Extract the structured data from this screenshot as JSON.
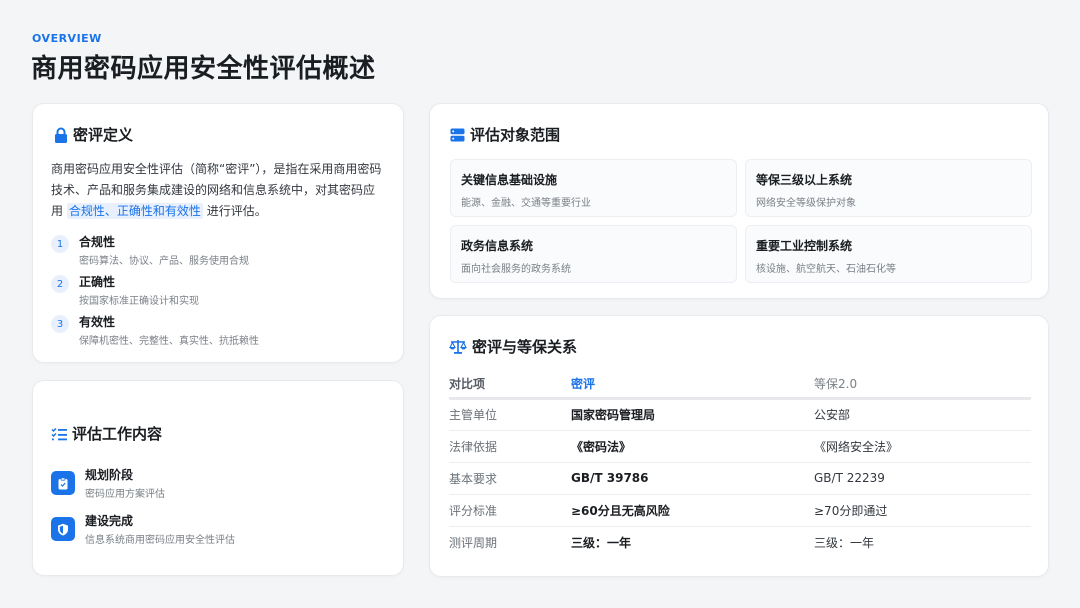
{
  "header": {
    "kicker": "OVERVIEW",
    "title": "商用密码应用安全性评估概述"
  },
  "colors": {
    "accent": "#1a73e8",
    "background": "#f4f5f7"
  },
  "definition": {
    "icon": "lock-icon",
    "title": "密评定义",
    "text_before": "商用密码应用安全性评估（简称“密评”），是指在采用商用密码技术、产品和服务集成建设的网络和信息系统中，对其密码应用",
    "highlight": "合规性、正确性和有效性",
    "text_after": "进行评估。",
    "criteria": [
      {
        "num": "1",
        "name": "合规性",
        "desc": "密码算法、协议、产品、服务使用合规"
      },
      {
        "num": "2",
        "name": "正确性",
        "desc": "按国家标准正确设计和实现"
      },
      {
        "num": "3",
        "name": "有效性",
        "desc": "保障机密性、完整性、真实性、抗抵赖性"
      }
    ]
  },
  "work": {
    "icon": "checklist-icon",
    "title": "评估工作内容",
    "items": [
      {
        "icon": "clipboard-icon",
        "name": "规划阶段",
        "desc": "密码应用方案评估"
      },
      {
        "icon": "shield-icon",
        "name": "建设完成",
        "desc": "信息系统商用密码应用安全性评估"
      }
    ]
  },
  "scope": {
    "icon": "server-icon",
    "title": "评估对象范围",
    "items": [
      {
        "name": "关键信息基础设施",
        "desc": "能源、金融、交通等重要行业"
      },
      {
        "name": "等保三级以上系统",
        "desc": "网络安全等级保护对象"
      },
      {
        "name": "政务信息系统",
        "desc": "面向社会服务的政务系统"
      },
      {
        "name": "重要工业控制系统",
        "desc": "核设施、航空航天、石油石化等"
      }
    ]
  },
  "relation": {
    "icon": "scale-icon",
    "title": "密评与等保关系",
    "headers": [
      "对比项",
      "密评",
      "等保2.0"
    ],
    "rows": [
      [
        "主管单位",
        "国家密码管理局",
        "公安部"
      ],
      [
        "法律依据",
        "《密码法》",
        "《网络安全法》"
      ],
      [
        "基本要求",
        "GB/T 39786",
        "GB/T 22239"
      ],
      [
        "评分标准",
        "≥60分且无高风险",
        "≥70分即通过"
      ],
      [
        "测评周期",
        "三级：一年",
        "三级：一年"
      ]
    ]
  }
}
